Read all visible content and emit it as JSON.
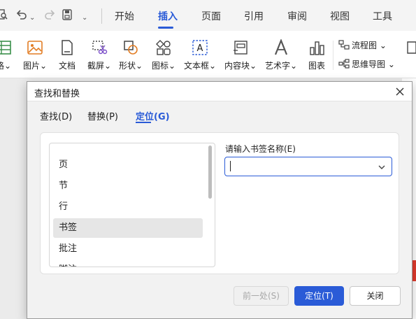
{
  "quick_access": {
    "chevron": "⌄",
    "icons": [
      "find-icon",
      "undo-icon",
      "redo-icon",
      "save-icon"
    ]
  },
  "menu": {
    "tabs": [
      "开始",
      "插入",
      "页面",
      "引用",
      "审阅",
      "视图",
      "工具"
    ],
    "active": "插入"
  },
  "ribbon": {
    "items": {
      "table_partial": "格",
      "picture": "图片",
      "document": "文档",
      "screenshot": "截屏",
      "shape": "形状",
      "icon": "图标",
      "textbox": "文本框",
      "content_block": "内容块",
      "wordart": "艺术字",
      "chart": "图表"
    },
    "flowchart": "流程图",
    "mindmap": "思维导图",
    "dropdown_glyph": "⌄"
  },
  "dialog": {
    "title": "查找和替换",
    "tabs": [
      "查找(D)",
      "替换(P)",
      "定位(G)"
    ],
    "active_tab": "定位(G)",
    "target_list": [
      "页",
      "节",
      "行",
      "书签",
      "批注",
      "脚注"
    ],
    "selected_target": "书签",
    "bookmark_label": "请输入书签名称(E)",
    "bookmark_value": "",
    "buttons": {
      "prev": "前一处(S)",
      "goto": "定位(T)",
      "close": "关闭"
    }
  },
  "colors": {
    "accent": "#2a5bd7",
    "disabled_text": "#a8a8a8",
    "doc_mark": "#e23b2e"
  }
}
